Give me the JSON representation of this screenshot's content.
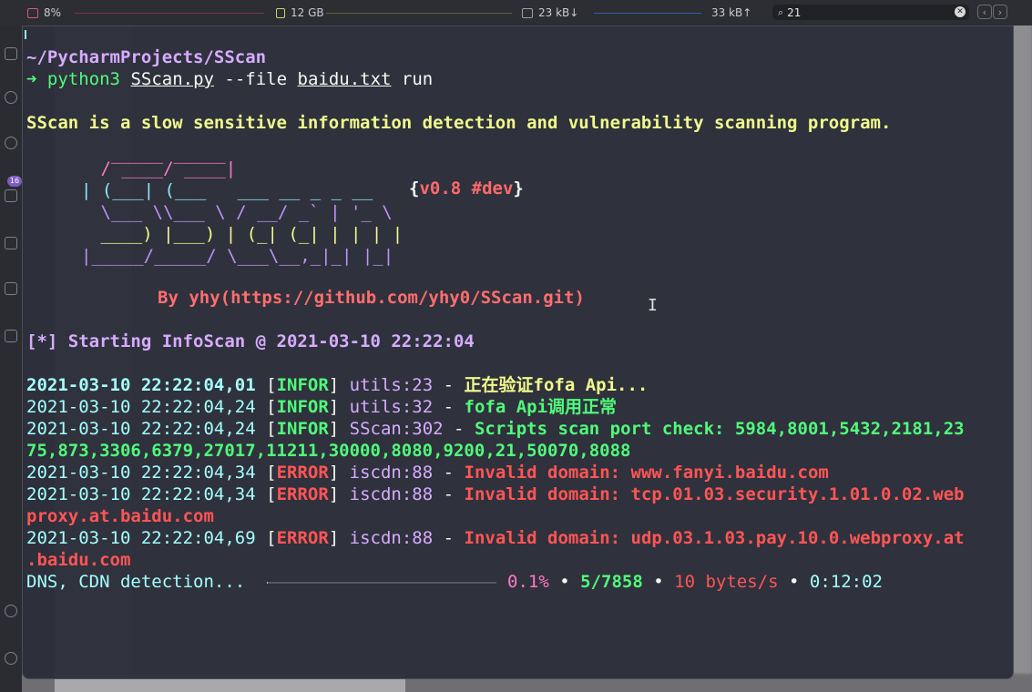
{
  "menubar": {
    "cpu_label": "8%",
    "mem_label": "12 GB",
    "net_down": "23 kB↓",
    "net_up": "33 kB↑",
    "search_value": "21"
  },
  "activitybar": {
    "badge": "16"
  },
  "terminal": {
    "cwd": "~/PycharmProjects/SScan",
    "prompt_arrow": "➜",
    "cmd_python": "python3",
    "cmd_script": "SScan.py",
    "cmd_flag": "--file",
    "cmd_file": "baidu.txt",
    "cmd_run": "run",
    "intro": "SScan is a slow sensitive information detection and vulnerability scanning program.",
    "banner_lines": [
      "  _____ _____",
      " / ____/ ____|",
      "| (___| (___   ___ __ _ _ __",
      " \\___ \\\\___ \\ / __/ _` | '_ \\",
      " ____) |___) | (_| (_| | | | |",
      "|_____/_____/ \\___\\__,_|_| |_|"
    ],
    "version": "{v0.8 #dev}",
    "version_open": "{",
    "version_text": "v0.8 #dev",
    "version_close": "}",
    "author": "By yhy(https://github.com/yhy0/SScan.git)",
    "start_line": "[*] Starting InfoScan @ 2021-03-10 22:22:04",
    "logs": [
      {
        "time": "2021-03-10 22:22:04,01",
        "level": "INFOR",
        "src": "utils:23",
        "msg": "正在验证fofa Api..."
      },
      {
        "time": "2021-03-10 22:22:04,24",
        "level": "INFOR",
        "src": "utils:32",
        "msg": "fofa Api调用正常"
      },
      {
        "time": "2021-03-10 22:22:04,24",
        "level": "INFOR",
        "src": "SScan:302",
        "msg": "Scripts scan port check: 5984,8001,5432,2181,23",
        "msg_cont": "75,873,3306,6379,27017,11211,30000,8080,9200,21,50070,8088"
      },
      {
        "time": "2021-03-10 22:22:04,34",
        "level": "ERROR",
        "src": "iscdn:88",
        "msg": "Invalid domain: www.fanyi.baidu.com"
      },
      {
        "time": "2021-03-10 22:22:04,34",
        "level": "ERROR",
        "src": "iscdn:88",
        "msg": "Invalid domain: tcp.01.03.security.1.01.0.02.web",
        "msg_cont": "proxy.at.baidu.com"
      },
      {
        "time": "2021-03-10 22:22:04,69",
        "level": "ERROR",
        "src": "iscdn:88",
        "msg": "Invalid domain: udp.03.1.03.pay.10.0.webproxy.at",
        "msg_cont": ".baidu.com"
      }
    ],
    "progress": {
      "label": "DNS, CDN detection...",
      "fraction": 0.001,
      "percent": "0.1%",
      "count": "5/7858",
      "rate": "10 bytes/s",
      "eta": "0:12:02",
      "sep": "•"
    }
  },
  "colors": {
    "background": "#282a36",
    "cyan": "#8be9fd",
    "green": "#50fa7b",
    "yellow": "#f1fa8c",
    "red": "#ff5555",
    "purple": "#bd93f9",
    "pink": "#ff79c6"
  }
}
